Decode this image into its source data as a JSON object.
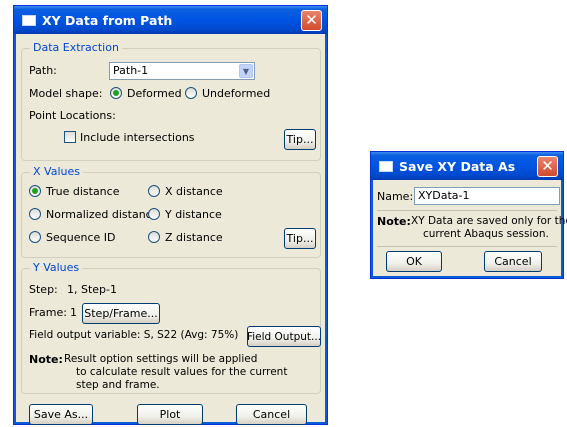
{
  "main_dialog": {
    "title": "XY Data from Path",
    "data_extraction": {
      "legend": "Data Extraction",
      "path_label": "Path:",
      "path_value": "Path-1",
      "model_shape_label": "Model shape:",
      "deformed_label": "Deformed",
      "undeformed_label": "Undeformed",
      "model_shape_selected": "Deformed",
      "point_locations_label": "Point Locations:",
      "include_intersections_label": "Include intersections",
      "include_intersections_checked": false,
      "tip_label": "Tip..."
    },
    "x_values": {
      "legend": "X Values",
      "true_distance": "True distance",
      "normalized_distance": "Normalized distance",
      "sequence_id": "Sequence ID",
      "x_distance": "X distance",
      "y_distance": "Y distance",
      "z_distance": "Z distance",
      "selected": "True distance",
      "tip_label": "Tip..."
    },
    "y_values": {
      "legend": "Y Values",
      "step_label": "Step:",
      "step_value": "1, Step-1",
      "frame_label": "Frame:",
      "frame_value": "1",
      "step_frame_button": "Step/Frame...",
      "field_output_text": "Field output variable:  S, S22 (Avg: 75%)",
      "field_output_button": "Field Output...",
      "note_label": "Note:",
      "note_text": [
        "Result option settings will be applied",
        "to calculate result values for the current",
        "step and frame."
      ]
    },
    "buttons": {
      "save_as": "Save As...",
      "plot": "Plot",
      "cancel": "Cancel"
    }
  },
  "save_dialog": {
    "title": "Save XY Data As",
    "name_label": "Name:",
    "name_value": "XYData-1",
    "note_label": "Note:",
    "note_text": [
      "XY Data are saved only for the",
      "current Abaqus session."
    ],
    "ok": "OK",
    "cancel": "Cancel"
  },
  "colors": {
    "title_bar": "#0054e3",
    "dialog_face": "#ece9d8",
    "group_legend": "#0046d5",
    "close_button": "#d14a2c",
    "radio_selected": "#21a121"
  }
}
